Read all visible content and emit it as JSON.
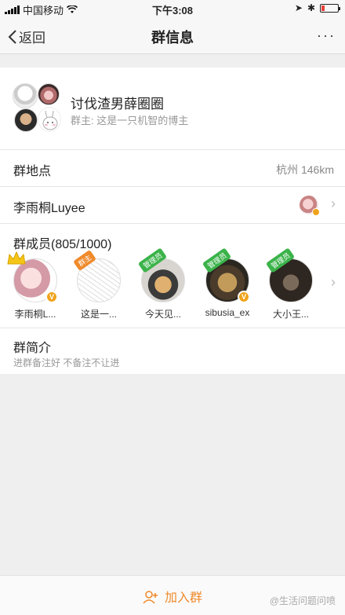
{
  "status_bar": {
    "carrier": "中国移动",
    "time": "下午3:08"
  },
  "nav": {
    "back_label": "返回",
    "title": "群信息",
    "more_label": "···"
  },
  "group": {
    "name": "讨伐渣男薛圈圈",
    "owner_note": "群主: 这是一只机智的博主"
  },
  "location": {
    "label": "群地点",
    "value": "杭州 146km"
  },
  "owner_row": {
    "label": "李雨桐Luyee"
  },
  "members": {
    "label": "群成员(805/1000)",
    "list": [
      {
        "name": "李雨桐L...",
        "tag": ""
      },
      {
        "name": "这是一...",
        "tag": "群主"
      },
      {
        "name": "今天见...",
        "tag": "管理员"
      },
      {
        "name": "sibusia_ex",
        "tag": "管理员"
      },
      {
        "name": "大小王...",
        "tag": "管理员"
      }
    ]
  },
  "intro": {
    "label": "群简介",
    "desc": "进群备注好 不备注不让进"
  },
  "bottom": {
    "join_label": "加入群",
    "watermark": "@生活问题问喷"
  },
  "colors": {
    "accent": "#f08a2b",
    "admin_tag": "#3bb34a",
    "verified": "#f0a31a"
  },
  "icons": [
    "chevron-left-icon",
    "more-icon",
    "chevron-right-icon",
    "add-group-icon",
    "wifi-icon",
    "battery-icon"
  ]
}
